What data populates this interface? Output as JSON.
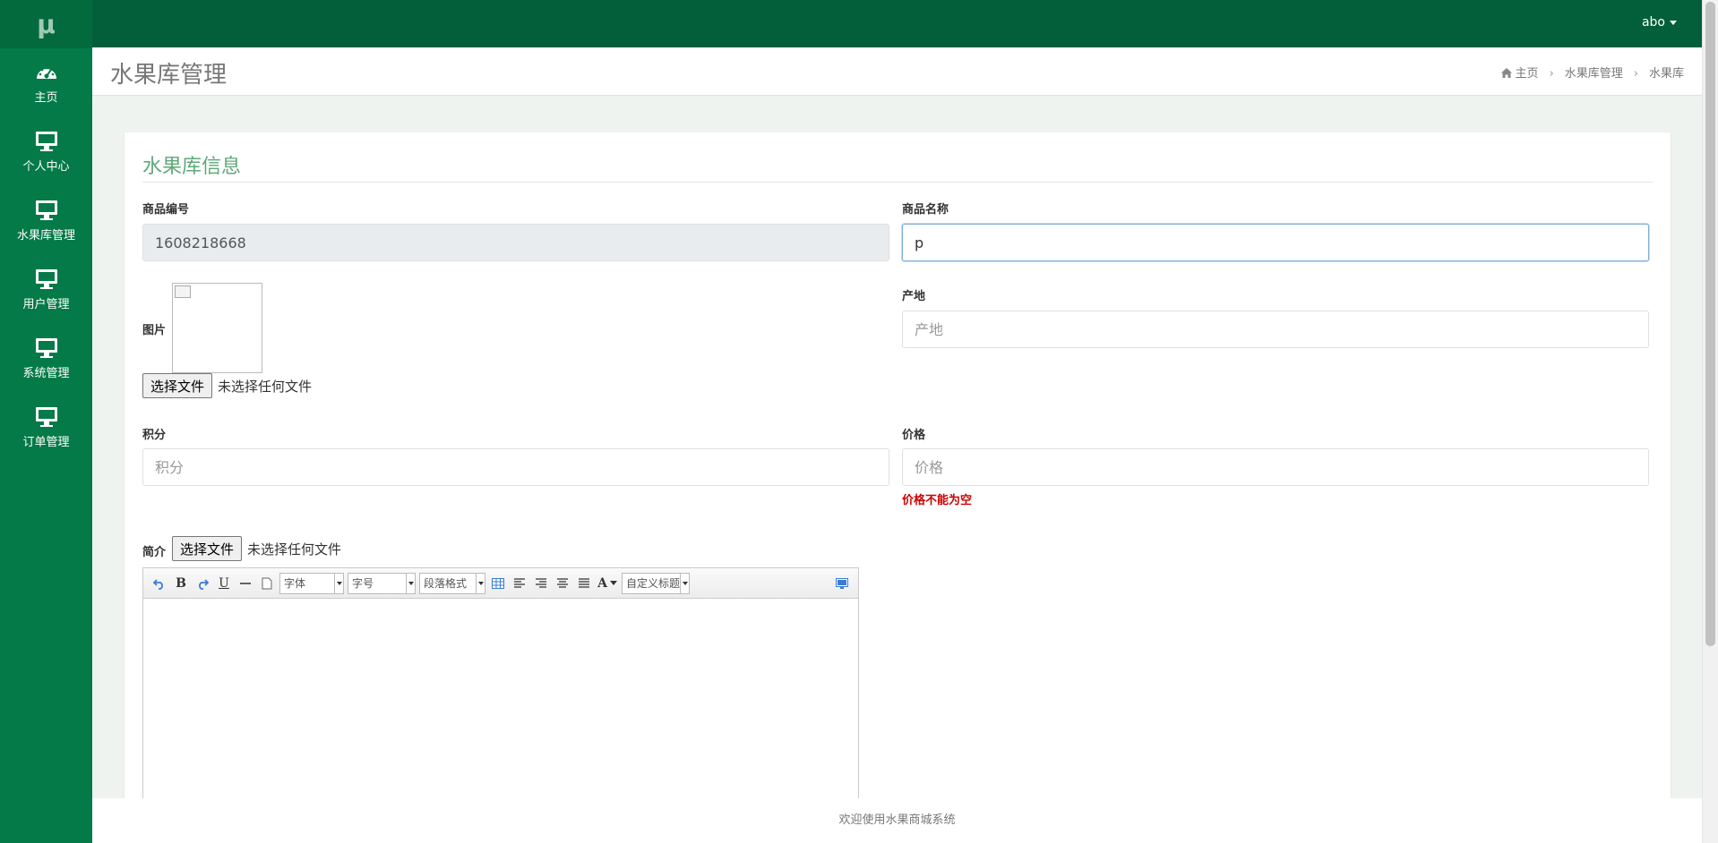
{
  "app": {
    "logo": "μ",
    "user": "abo"
  },
  "sidebar": {
    "items": [
      {
        "label": "主页",
        "icon": "dashboard-icon"
      },
      {
        "label": "个人中心",
        "icon": "monitor-icon"
      },
      {
        "label": "水果库管理",
        "icon": "monitor-icon"
      },
      {
        "label": "用户管理",
        "icon": "monitor-icon"
      },
      {
        "label": "系统管理",
        "icon": "monitor-icon"
      },
      {
        "label": "订单管理",
        "icon": "monitor-icon"
      }
    ]
  },
  "header": {
    "title": "水果库管理",
    "breadcrumb": [
      "主页",
      "水果库管理",
      "水果库"
    ]
  },
  "form": {
    "title": "水果库信息",
    "product_id": {
      "label": "商品编号",
      "value": "1608218668"
    },
    "product_name": {
      "label": "商品名称",
      "value": "p"
    },
    "image": {
      "label": "图片"
    },
    "origin": {
      "label": "产地",
      "placeholder": "产地"
    },
    "points": {
      "label": "积分",
      "placeholder": "积分"
    },
    "price": {
      "label": "价格",
      "placeholder": "价格",
      "error": "价格不能为空"
    },
    "intro": {
      "label": "简介"
    },
    "file_button": "选择文件",
    "file_none": "未选择任何文件"
  },
  "editor": {
    "font_select": "字体",
    "size_select": "字号",
    "paragraph_select": "段落格式",
    "custom_title_select": "自定义标题",
    "bold": "B",
    "underline": "U",
    "font_color": "A"
  },
  "footer": {
    "text": "欢迎使用水果商城系统"
  }
}
